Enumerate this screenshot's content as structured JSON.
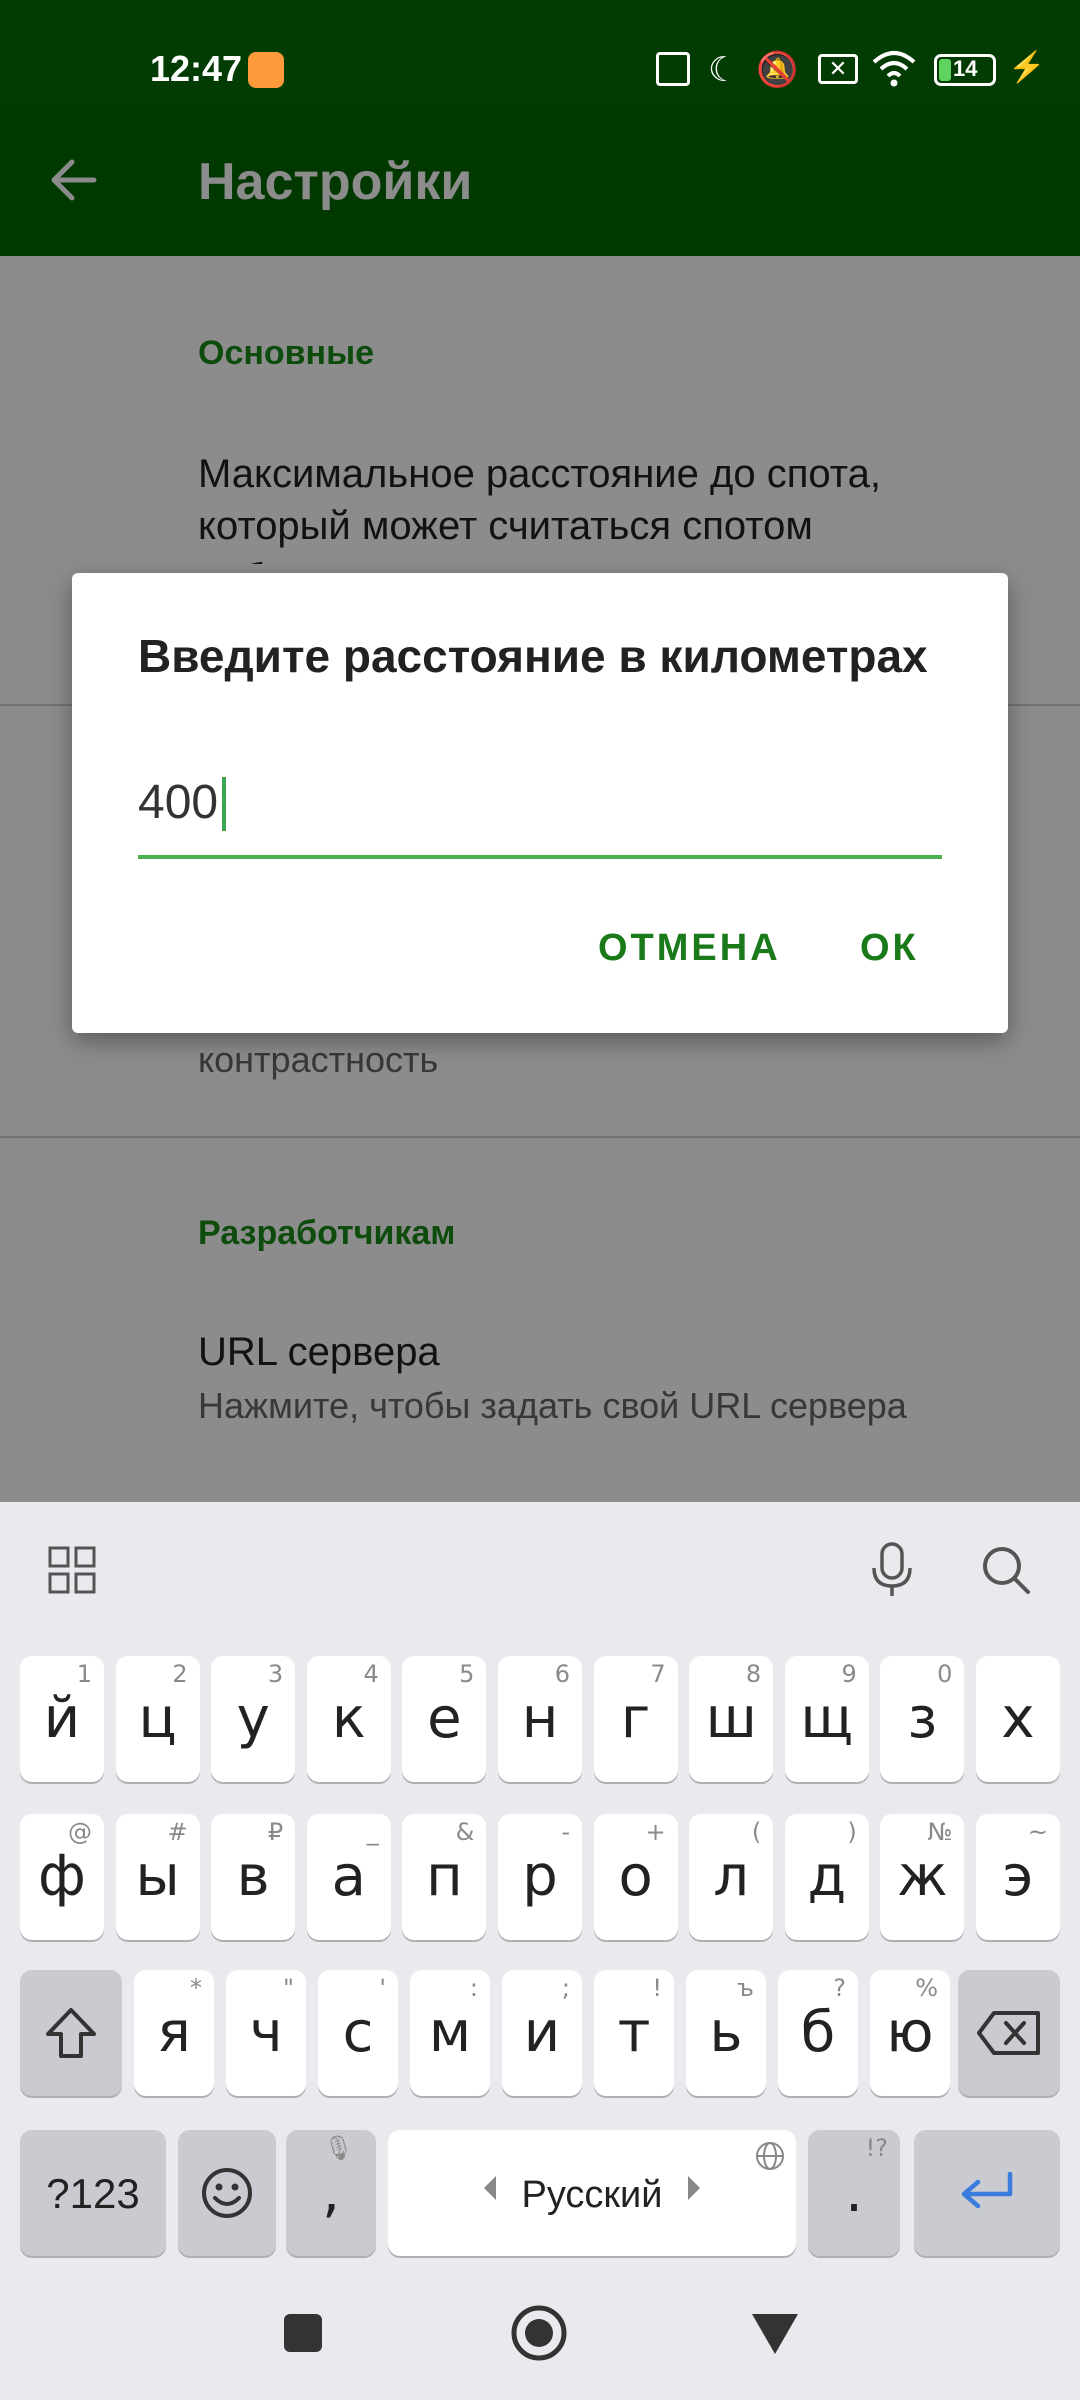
{
  "status_bar": {
    "time": "12:47",
    "battery_level": "14",
    "icons": [
      "notification-app-icon",
      "nfc-icon",
      "do-not-disturb-moon-icon",
      "mute-icon",
      "no-sim-icon",
      "wifi-icon",
      "battery-icon",
      "charging-icon"
    ]
  },
  "app_bar": {
    "back_icon": "arrow-left-icon",
    "title": "Настройки"
  },
  "settings": {
    "section_main": "Основные",
    "item_distance_title": "Максимальное расстояние до спота, который может считаться спотом поблизости",
    "item_contrast_sub": "Уменьшит яркость карты и улучшит контрастность",
    "section_dev": "Разработчикам",
    "item_url_title": "URL сервера",
    "item_url_sub": "Нажмите, чтобы задать свой URL сервера"
  },
  "dialog": {
    "title": "Введите расстояние в километрах",
    "input_value": "400",
    "cancel_label": "ОТМЕНА",
    "ok_label": "ОК"
  },
  "keyboard": {
    "toolbar_icons": [
      "apps-grid-icon",
      "microphone-icon",
      "search-icon"
    ],
    "row1": [
      {
        "k": "й",
        "a": "1"
      },
      {
        "k": "ц",
        "a": "2"
      },
      {
        "k": "у",
        "a": "3"
      },
      {
        "k": "к",
        "a": "4"
      },
      {
        "k": "е",
        "a": "5"
      },
      {
        "k": "н",
        "a": "6"
      },
      {
        "k": "г",
        "a": "7"
      },
      {
        "k": "ш",
        "a": "8"
      },
      {
        "k": "щ",
        "a": "9"
      },
      {
        "k": "з",
        "a": "0"
      },
      {
        "k": "х",
        "a": ""
      }
    ],
    "row2": [
      {
        "k": "ф",
        "a": "@"
      },
      {
        "k": "ы",
        "a": "#"
      },
      {
        "k": "в",
        "a": "₽"
      },
      {
        "k": "а",
        "a": "_"
      },
      {
        "k": "п",
        "a": "&"
      },
      {
        "k": "р",
        "a": "-"
      },
      {
        "k": "о",
        "a": "+"
      },
      {
        "k": "л",
        "a": "("
      },
      {
        "k": "д",
        "a": ")"
      },
      {
        "k": "ж",
        "a": "№"
      },
      {
        "k": "э",
        "a": "~"
      }
    ],
    "row3": [
      {
        "k": "я",
        "a": "*"
      },
      {
        "k": "ч",
        "a": "\""
      },
      {
        "k": "с",
        "a": "'"
      },
      {
        "k": "м",
        "a": ":"
      },
      {
        "k": "и",
        "a": ";"
      },
      {
        "k": "т",
        "a": "!"
      },
      {
        "k": "ь",
        "a": "ъ"
      },
      {
        "k": "б",
        "a": "?"
      },
      {
        "k": "ю",
        "a": "%"
      }
    ],
    "symbols_label": "?123",
    "comma_label": ",",
    "space_label": "Русский",
    "period_label": ".",
    "period_alt": "!?"
  },
  "nav_bar": {
    "icons": [
      "recent-apps-square-icon",
      "home-circle-icon",
      "back-triangle-icon"
    ]
  }
}
